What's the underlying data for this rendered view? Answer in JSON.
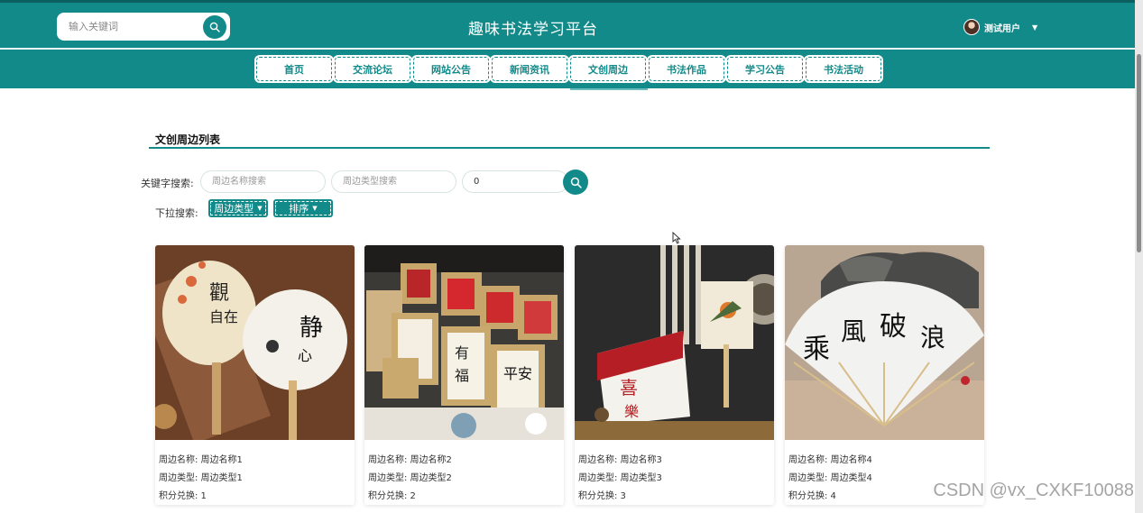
{
  "header": {
    "search_placeholder": "输入关键词",
    "site_title": "趣味书法学习平台",
    "user_name": "测试用户"
  },
  "nav": {
    "items": [
      {
        "label": "首页"
      },
      {
        "label": "交流论坛"
      },
      {
        "label": "网站公告"
      },
      {
        "label": "新闻资讯"
      },
      {
        "label": "文创周边",
        "active": true
      },
      {
        "label": "书法作品"
      },
      {
        "label": "学习公告"
      },
      {
        "label": "书法活动"
      }
    ]
  },
  "section": {
    "title": "文创周边列表"
  },
  "filters": {
    "keyword_label": "关键字搜索:",
    "name_placeholder": "周边名称搜索",
    "type_placeholder": "周边类型搜索",
    "points_value": "0",
    "dropdown_label": "下拉搜索:",
    "type_button": "周边类型",
    "sort_button": "排序"
  },
  "products": [
    {
      "name_label": "周边名称: 周边名称1",
      "type_label": "周边类型: 周边类型1",
      "points_label": "积分兑换: 1"
    },
    {
      "name_label": "周边名称: 周边名称2",
      "type_label": "周边类型: 周边类型2",
      "points_label": "积分兑换: 2"
    },
    {
      "name_label": "周边名称: 周边名称3",
      "type_label": "周边类型: 周边类型3",
      "points_label": "积分兑换: 3"
    },
    {
      "name_label": "周边名称: 周边名称4",
      "type_label": "周边类型: 周边类型4",
      "points_label": "积分兑换: 4"
    }
  ],
  "watermark": "CSDN @vx_CXKF10088",
  "colors": {
    "primary": "#138a8a",
    "header_line": "#0c5f5f"
  },
  "icons": {
    "search": "search-icon",
    "caret": "caret-down-icon",
    "avatar": "avatar",
    "cursor": "mouse-cursor-icon"
  }
}
